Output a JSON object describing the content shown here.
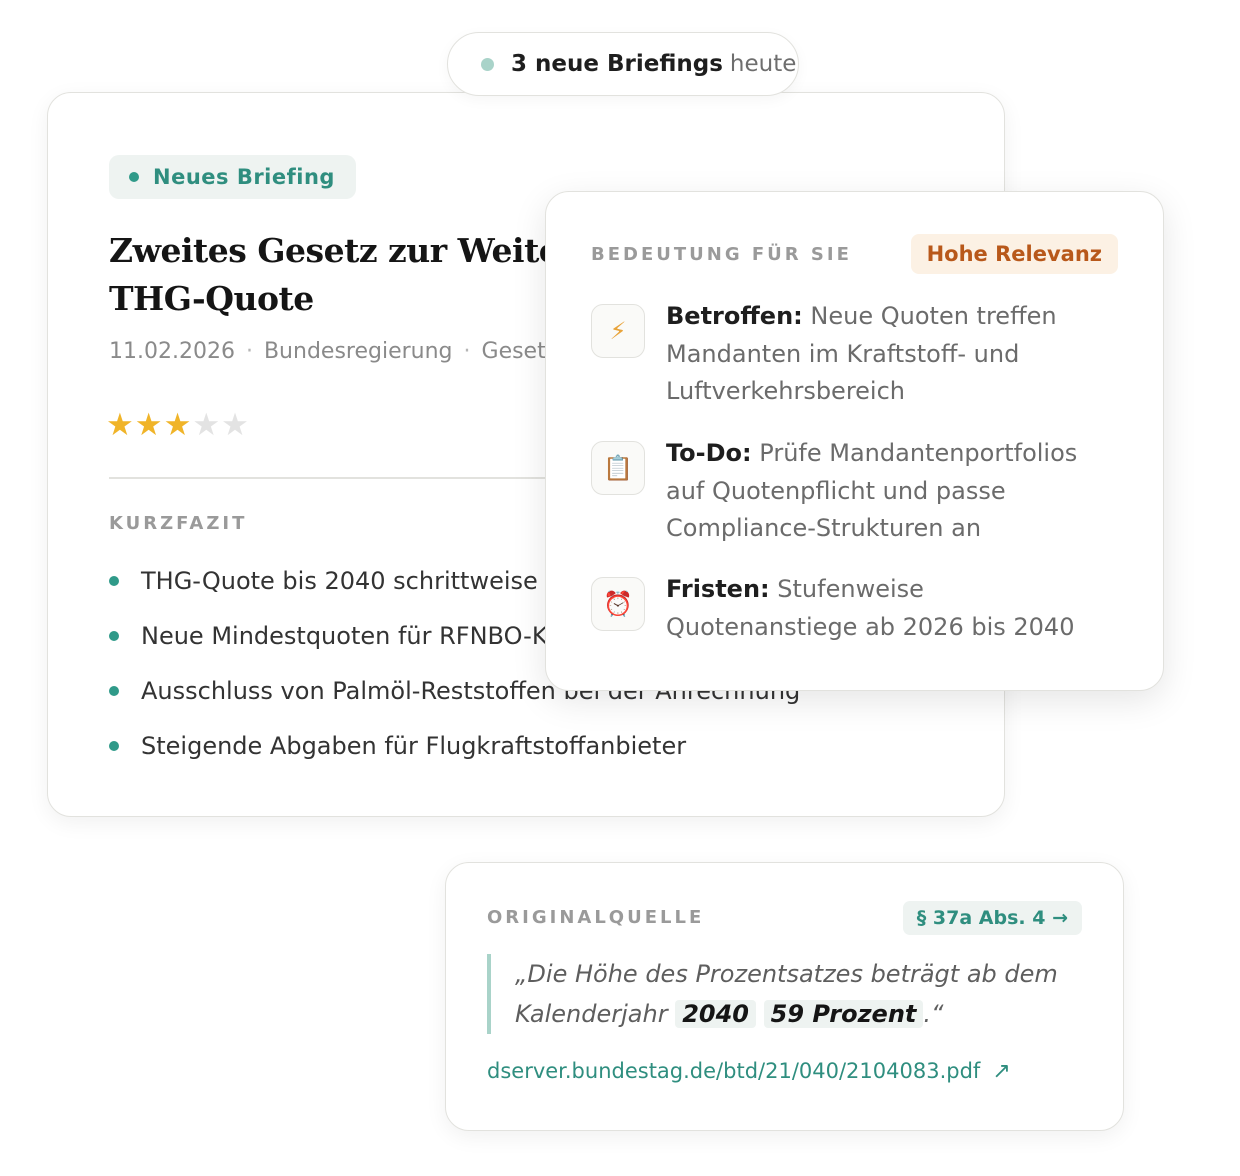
{
  "top_pill": {
    "count_text": "3 neue Briefings",
    "suffix": "heute"
  },
  "briefing": {
    "badge": "Neues Briefing",
    "title_line1": "Zweites Gesetz zur Weiterentwicklung der",
    "title_line2": "THG-Quote",
    "date": "11.02.2026",
    "source": "Bundesregierung",
    "category": "Gesetzgebung",
    "rating": 3,
    "rating_max": 5,
    "stars_on": "★★★",
    "stars_off": "★★",
    "summary_label": "KURZFAZIT",
    "summary_items": [
      "THG-Quote bis 2040 schrittweise angehoben",
      "Neue Mindestquoten für RFNBO-Kraftstoffe",
      "Ausschluss von Palmöl-Reststoffen bei der Anrechnung",
      "Steigende Abgaben für Flugkraftstoffanbieter"
    ]
  },
  "relevance": {
    "label": "BEDEUTUNG FÜR SIE",
    "badge": "Hohe Relevanz",
    "items": [
      {
        "icon": "lightning-icon",
        "glyph": "⚡",
        "key": "Betroffen:",
        "text": "Neue Quoten treffen Mandanten im Kraftstoff- und Luftverkehrsbereich"
      },
      {
        "icon": "clipboard-icon",
        "glyph": "📋",
        "key": "To-Do:",
        "text": "Prüfe Mandantenportfolios auf Quotenpflicht und passe Compliance-Strukturen an"
      },
      {
        "icon": "alarm-clock-icon",
        "glyph": "⏰",
        "key": "Fristen:",
        "text": "Stufenweise Quotenanstiege ab 2026 bis 2040"
      }
    ]
  },
  "source_card": {
    "label": "ORIGINALQUELLE",
    "paragraph": "§ 37a Abs. 4 →",
    "quote_pre": "„Die Höhe des Prozentsatzes beträgt ab dem Kalenderjahr",
    "quote_hl1": "2040",
    "quote_hl2": "59 Prozent",
    "quote_post": ".“",
    "link": "dserver.bundestag.de/btd/21/040/2104083.pdf",
    "link_arrow": "↗"
  },
  "colors": {
    "accent": "#2f9a89",
    "star": "#f0b429",
    "relevance": "#b8581a"
  }
}
